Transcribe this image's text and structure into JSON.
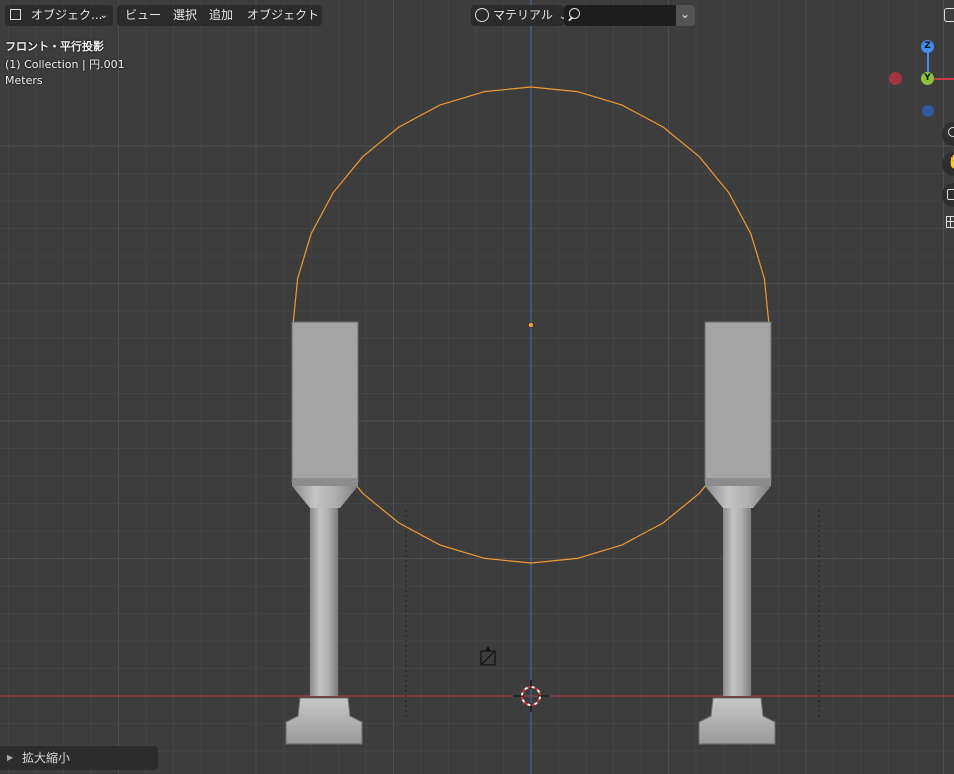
{
  "header": {
    "mode_label": "オブジェク...",
    "menus": [
      "ビュー",
      "選択",
      "追加",
      "オブジェクト"
    ],
    "shading_label": "マテリアル",
    "search_value": ""
  },
  "overlay": {
    "view_name": "フロント・平行投影",
    "collection": "(1) Collection | 円.001",
    "units": "Meters"
  },
  "gizmo": {
    "z_label": "Z",
    "y_label": "Y",
    "x_color": "#c93947",
    "y_color": "#8ac33b",
    "z_color": "#3f8ef0"
  },
  "side_tools": [
    "zoom-icon",
    "hand-pan-icon",
    "camera-icon",
    "grid-toggle-icon"
  ],
  "operator_panel": {
    "label": "拡大縮小"
  },
  "colors": {
    "viewport_bg": "#3d3d3d",
    "grid_minor": "#454545",
    "grid_major": "#4e4e4e",
    "x_axis": "#b33a3a",
    "z_axis": "#3c6db5",
    "selection": "#f29a2e",
    "mesh_light": "#b9b9b9",
    "mesh_dark": "#8e8e8e"
  }
}
